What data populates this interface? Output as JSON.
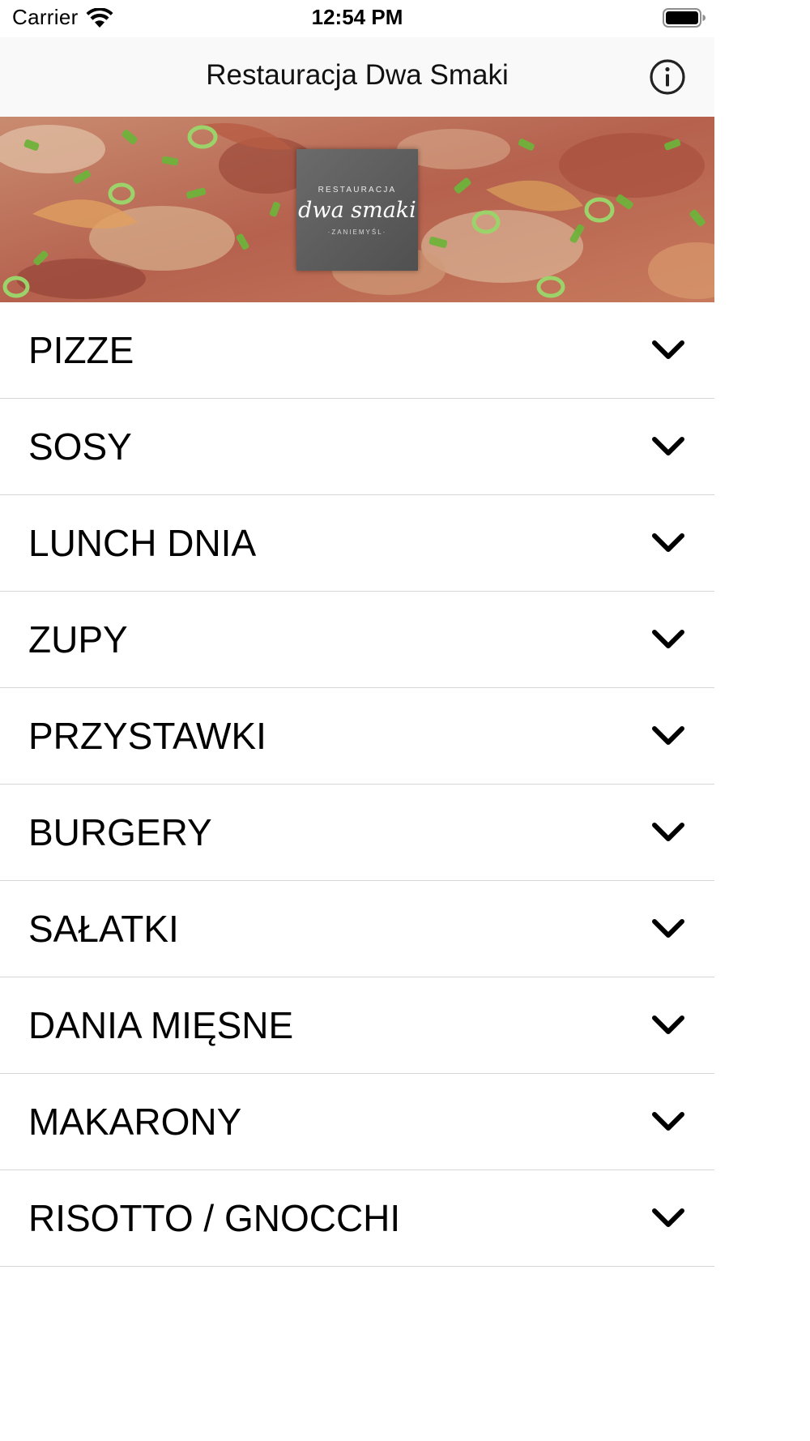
{
  "status_bar": {
    "carrier": "Carrier",
    "time": "12:54 PM"
  },
  "nav": {
    "title": "Restauracja Dwa Smaki",
    "info_icon": "info-circle-icon"
  },
  "banner": {
    "logo_top": "RESTAURACJA",
    "logo_main": "dwa smaki",
    "logo_bottom": "·ZANIEMYŚL·"
  },
  "menu": {
    "items": [
      {
        "label": "PIZZE"
      },
      {
        "label": "SOSY"
      },
      {
        "label": "LUNCH DNIA"
      },
      {
        "label": "ZUPY"
      },
      {
        "label": "PRZYSTAWKI"
      },
      {
        "label": "BURGERY"
      },
      {
        "label": "SAŁATKI"
      },
      {
        "label": "DANIA MIĘSNE"
      },
      {
        "label": "MAKARONY"
      },
      {
        "label": "RISOTTO / GNOCCHI"
      }
    ],
    "chevron_icon": "chevron-down-icon"
  }
}
